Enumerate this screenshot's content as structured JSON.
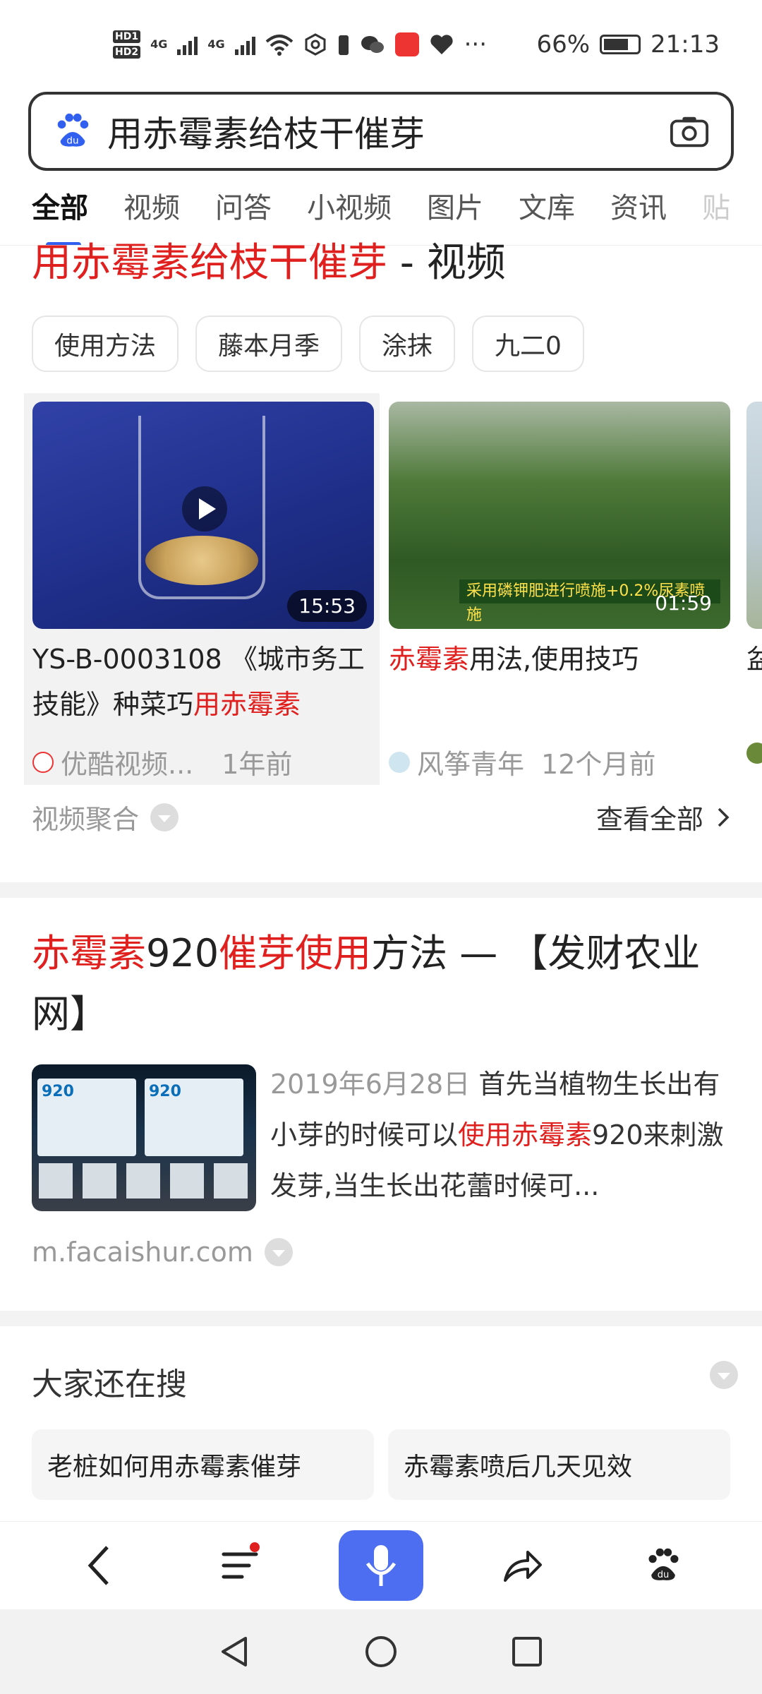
{
  "status_bar": {
    "hd1": "HD1",
    "hd2": "HD2",
    "net1": "4G",
    "net2": "4G",
    "more": "···",
    "battery_pct": "66%",
    "time": "21:13"
  },
  "search": {
    "query": "用赤霉素给枝干催芽"
  },
  "tabs": [
    "全部",
    "视频",
    "问答",
    "小视频",
    "图片",
    "文库",
    "资讯",
    "贴"
  ],
  "video_section": {
    "title_red": "用赤霉素给枝干催芽",
    "title_rest": " - 视频",
    "chips": [
      "使用方法",
      "藤本月季",
      "涂抹",
      "九二0"
    ],
    "cards": [
      {
        "duration": "15:53",
        "title_plain": "YS-B-0003108 《城市务工技能》种菜巧",
        "title_red": "用赤霉素",
        "source": "优酷视频...",
        "time": "1年前"
      },
      {
        "duration": "01:59",
        "banner": "采用磷钾肥进行喷施+0.2%尿素喷施",
        "title_red": "赤霉素",
        "title_plain": "用法,使用技巧",
        "source": "风筝青年",
        "time": "12个月前"
      },
      {
        "title_plain": "盆"
      }
    ],
    "aggregate_label": "视频聚合",
    "view_all": "查看全部"
  },
  "result": {
    "title_parts": [
      {
        "text": "赤霉素",
        "red": true
      },
      {
        "text": "920",
        "red": false
      },
      {
        "text": "催芽使用",
        "red": true
      },
      {
        "text": "方法 — 【发财农业网】",
        "red": false
      }
    ],
    "date": "2019年6月28日",
    "snippet_1": " 首先当植物生长出有小芽的时候可以",
    "snippet_red": "使用赤霉素",
    "snippet_2": "920来刺激发芽,当生长出花蕾时候可...",
    "img_label": "920",
    "url": "m.facaishur.com"
  },
  "others": {
    "heading": "大家还在搜",
    "items": [
      "老桩如何用赤霉素催芽",
      "赤霉素喷后几天见效"
    ]
  },
  "icons": {
    "back": "back-arrow-icon",
    "menu": "menu-icon",
    "mic": "microphone-icon",
    "share": "share-icon",
    "home": "baidu-paw-icon"
  },
  "colors": {
    "accent": "#4e6ef2",
    "highlight": "#e0201e",
    "tab_indicator": "#3160f0"
  }
}
